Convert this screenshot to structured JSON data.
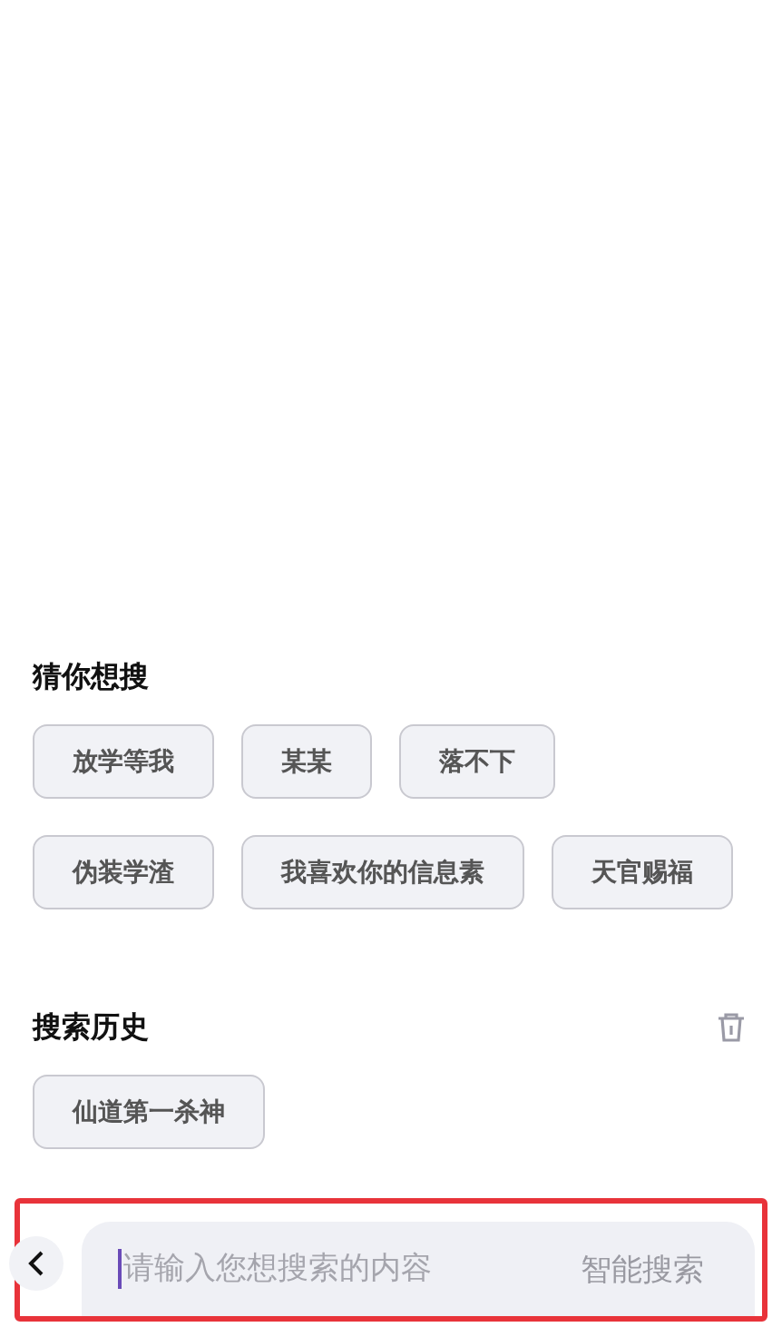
{
  "suggestions": {
    "title": "猜你想搜",
    "chips": [
      {
        "label": "放学等我"
      },
      {
        "label": "某某"
      },
      {
        "label": "落不下"
      },
      {
        "label": "伪装学渣"
      },
      {
        "label": "我喜欢你的信息素"
      },
      {
        "label": "天官赐福"
      }
    ]
  },
  "history": {
    "title": "搜索历史",
    "chips": [
      {
        "label": "仙道第一杀神"
      }
    ]
  },
  "search_bar": {
    "highlighted": true,
    "placeholder": "请输入您想搜索的内容",
    "action": "智能搜索"
  }
}
